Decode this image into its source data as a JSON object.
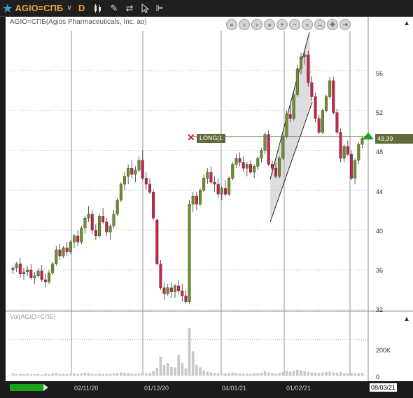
{
  "toolbar": {
    "symbol": "AGIO=СПБ",
    "period": "D",
    "icons": [
      "star-icon",
      "dropdown-icon",
      "candles-icon",
      "draw-icon",
      "trade-icon",
      "cursor-icon",
      "settings-icon"
    ]
  },
  "chart": {
    "title": "AGIO=СПБ(Agios Pharmaceuticals, Inc. ao)",
    "last_price": "49,39",
    "position_label": "LONG|1",
    "y_ticks": [
      "56",
      "52",
      "48",
      "44",
      "40",
      "36",
      "32"
    ],
    "volume_title": "Vol(AGIO=СПБ)",
    "volume_ticks": [
      "200K",
      "0"
    ],
    "x_labels": [
      "02/11/20",
      "01/12/20",
      "04/01/21",
      "01/02/21"
    ],
    "current_date": "08/03/21",
    "colors": {
      "up": "#6f8f26",
      "down": "#c8214a",
      "volume": "#c8c8c8"
    }
  },
  "chart_data": {
    "type": "candlestick",
    "ylim": [
      32,
      60
    ],
    "volume_ylim": [
      0,
      280000
    ],
    "candles": [
      [
        36.0,
        36.4,
        35.6,
        36.2
      ],
      [
        36.2,
        36.8,
        35.8,
        36.6
      ],
      [
        36.6,
        37.2,
        35.2,
        35.6
      ],
      [
        35.6,
        36.2,
        35.0,
        35.8
      ],
      [
        35.8,
        36.4,
        35.4,
        36.0
      ],
      [
        36.0,
        36.6,
        35.0,
        35.2
      ],
      [
        35.2,
        35.8,
        34.6,
        35.4
      ],
      [
        35.4,
        36.2,
        35.2,
        35.9
      ],
      [
        35.9,
        36.5,
        34.8,
        35.0
      ],
      [
        35.0,
        35.6,
        34.2,
        34.8
      ],
      [
        34.8,
        36.0,
        34.6,
        35.7
      ],
      [
        35.7,
        36.8,
        35.5,
        36.6
      ],
      [
        36.6,
        38.4,
        36.4,
        38.0
      ],
      [
        38.0,
        38.6,
        37.0,
        37.4
      ],
      [
        37.4,
        38.4,
        37.2,
        38.2
      ],
      [
        38.2,
        38.8,
        37.4,
        37.8
      ],
      [
        37.8,
        39.0,
        37.6,
        38.8
      ],
      [
        38.8,
        39.6,
        38.2,
        39.4
      ],
      [
        39.4,
        40.0,
        38.4,
        38.8
      ],
      [
        38.8,
        40.4,
        38.6,
        40.2
      ],
      [
        40.2,
        41.4,
        39.6,
        41.2
      ],
      [
        41.2,
        42.4,
        40.8,
        41.6
      ],
      [
        41.6,
        42.0,
        39.6,
        40.0
      ],
      [
        40.0,
        40.6,
        39.0,
        39.4
      ],
      [
        39.4,
        41.6,
        39.2,
        41.4
      ],
      [
        41.4,
        42.2,
        40.6,
        40.8
      ],
      [
        40.8,
        41.2,
        39.4,
        39.8
      ],
      [
        39.8,
        40.6,
        39.0,
        40.4
      ],
      [
        40.4,
        42.0,
        40.2,
        41.6
      ],
      [
        41.6,
        43.2,
        41.4,
        43.0
      ],
      [
        43.0,
        44.8,
        42.8,
        44.6
      ],
      [
        44.6,
        45.8,
        44.0,
        45.4
      ],
      [
        45.4,
        46.6,
        44.6,
        46.2
      ],
      [
        46.2,
        47.0,
        45.2,
        45.6
      ],
      [
        45.6,
        46.4,
        44.8,
        46.0
      ],
      [
        46.0,
        47.4,
        45.8,
        47.0
      ],
      [
        47.0,
        48.0,
        45.0,
        45.2
      ],
      [
        45.2,
        45.8,
        44.0,
        44.6
      ],
      [
        44.6,
        45.2,
        43.6,
        43.8
      ],
      [
        43.8,
        44.0,
        41.0,
        41.2
      ],
      [
        41.0,
        41.2,
        36.4,
        36.6
      ],
      [
        36.6,
        37.0,
        34.0,
        34.2
      ],
      [
        34.2,
        34.8,
        33.0,
        33.6
      ],
      [
        33.6,
        34.6,
        33.4,
        34.2
      ],
      [
        34.2,
        34.8,
        33.2,
        33.8
      ],
      [
        33.8,
        34.6,
        33.2,
        34.4
      ],
      [
        34.4,
        35.0,
        33.6,
        33.9
      ],
      [
        33.9,
        34.6,
        32.8,
        33.4
      ],
      [
        33.4,
        34.0,
        32.6,
        32.8
      ],
      [
        32.8,
        43.0,
        32.6,
        42.6
      ],
      [
        42.6,
        43.8,
        41.8,
        43.4
      ],
      [
        43.4,
        43.8,
        42.0,
        42.6
      ],
      [
        42.6,
        44.2,
        42.4,
        44.0
      ],
      [
        44.0,
        45.6,
        43.8,
        45.2
      ],
      [
        45.2,
        46.2,
        44.6,
        45.8
      ],
      [
        45.8,
        46.4,
        44.6,
        44.8
      ],
      [
        44.8,
        45.4,
        43.8,
        44.6
      ],
      [
        44.6,
        45.2,
        43.2,
        43.6
      ],
      [
        43.6,
        44.4,
        43.0,
        44.2
      ],
      [
        44.2,
        45.0,
        43.4,
        43.6
      ],
      [
        43.6,
        45.4,
        43.4,
        45.2
      ],
      [
        45.2,
        46.8,
        45.0,
        46.6
      ],
      [
        46.6,
        47.6,
        46.2,
        47.2
      ],
      [
        47.2,
        47.8,
        46.4,
        46.8
      ],
      [
        46.8,
        47.4,
        45.8,
        46.2
      ],
      [
        46.2,
        46.8,
        45.4,
        46.6
      ],
      [
        46.6,
        47.0,
        45.6,
        45.8
      ],
      [
        45.8,
        46.6,
        45.2,
        46.4
      ],
      [
        46.4,
        47.4,
        46.0,
        47.2
      ],
      [
        47.2,
        48.2,
        46.8,
        48.0
      ],
      [
        48.0,
        49.8,
        47.6,
        49.6
      ],
      [
        49.6,
        50.0,
        46.4,
        46.6
      ],
      [
        46.6,
        47.0,
        45.6,
        46.2
      ],
      [
        46.2,
        46.8,
        45.2,
        45.4
      ],
      [
        45.4,
        47.4,
        45.2,
        47.2
      ],
      [
        47.2,
        49.6,
        47.0,
        49.4
      ],
      [
        49.4,
        52.0,
        49.2,
        51.6
      ],
      [
        51.6,
        52.6,
        50.8,
        51.2
      ],
      [
        51.2,
        53.8,
        51.0,
        53.6
      ],
      [
        53.6,
        56.6,
        53.4,
        56.2
      ],
      [
        56.2,
        57.8,
        55.6,
        57.4
      ],
      [
        57.4,
        58.2,
        56.6,
        57.6
      ],
      [
        57.6,
        58.0,
        54.4,
        54.8
      ],
      [
        54.8,
        55.4,
        53.0,
        53.4
      ],
      [
        53.4,
        53.8,
        50.8,
        51.2
      ],
      [
        51.2,
        51.6,
        49.6,
        49.8
      ],
      [
        49.8,
        52.2,
        49.6,
        52.0
      ],
      [
        52.0,
        53.6,
        51.8,
        53.4
      ],
      [
        53.4,
        55.4,
        53.2,
        55.0
      ],
      [
        55.0,
        55.4,
        51.6,
        51.8
      ],
      [
        51.8,
        52.2,
        49.6,
        49.8
      ],
      [
        49.8,
        50.2,
        46.8,
        47.2
      ],
      [
        47.2,
        48.6,
        46.8,
        48.4
      ],
      [
        48.4,
        49.0,
        47.4,
        47.6
      ],
      [
        47.6,
        48.0,
        45.0,
        45.2
      ],
      [
        45.2,
        47.2,
        44.6,
        47.0
      ],
      [
        47.0,
        48.8,
        46.6,
        48.6
      ],
      [
        48.6,
        49.4,
        48.2,
        49.2
      ]
    ],
    "volume": [
      12000,
      8000,
      10000,
      9000,
      11000,
      7000,
      8000,
      9000,
      6000,
      10000,
      8000,
      12000,
      15000,
      9000,
      11000,
      8000,
      10000,
      13000,
      9000,
      12000,
      16000,
      14000,
      10000,
      9000,
      11000,
      8000,
      9000,
      10000,
      12000,
      14000,
      18000,
      16000,
      15000,
      11000,
      9000,
      13000,
      15000,
      12000,
      14000,
      26000,
      42000,
      105000,
      58000,
      70000,
      48000,
      45000,
      115000,
      72000,
      40000,
      265000,
      135000,
      60000,
      45000,
      28000,
      22000,
      18000,
      15000,
      12000,
      14000,
      11000,
      13000,
      16000,
      14000,
      12000,
      10000,
      11000,
      9000,
      12000,
      14000,
      16000,
      26000,
      18000,
      14000,
      12000,
      15000,
      20000,
      28000,
      22000,
      26000,
      32000,
      30000,
      24000,
      20000,
      18000,
      16000,
      15000,
      17000,
      19000,
      22000,
      18000,
      16000,
      20000,
      14000,
      12000,
      15000,
      13000,
      12000,
      14000
    ]
  }
}
